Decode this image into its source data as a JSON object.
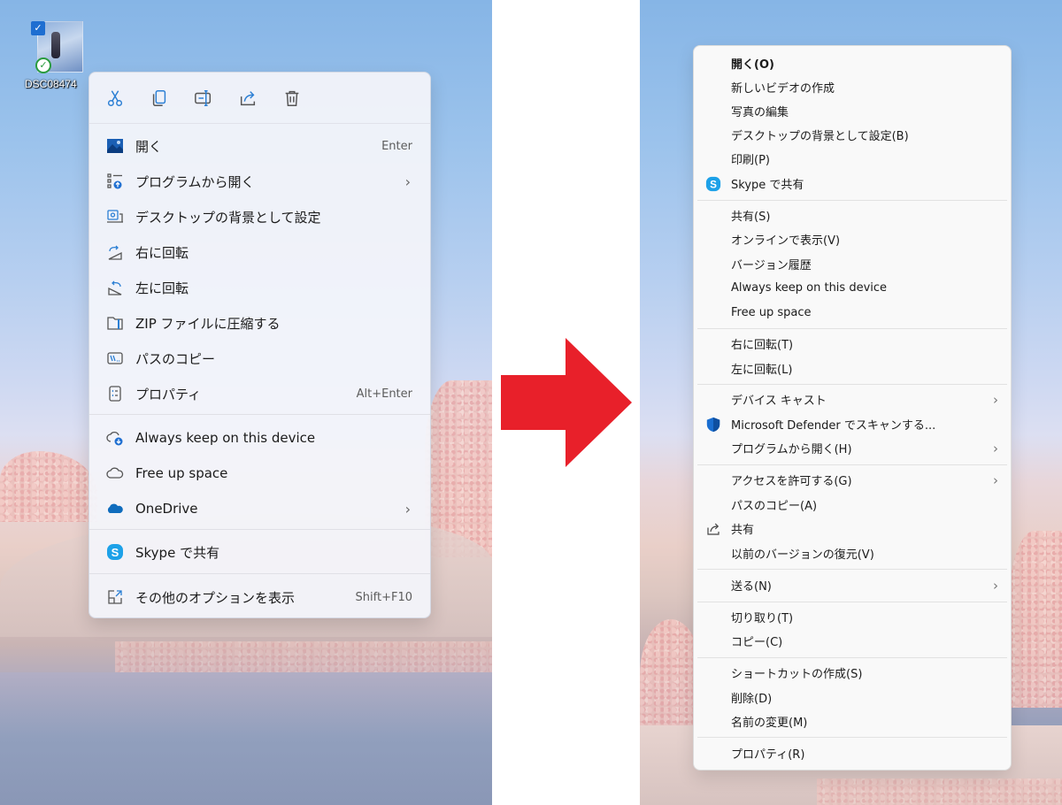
{
  "desktop_icon": {
    "filename": "DSC08474",
    "selected": true,
    "sync_status": "synced"
  },
  "left_menu": {
    "toolbar": [
      {
        "icon": "scissors-icon",
        "tooltip": "Cut"
      },
      {
        "icon": "copy-icon",
        "tooltip": "Copy"
      },
      {
        "icon": "rename-icon",
        "tooltip": "Rename"
      },
      {
        "icon": "share-icon",
        "tooltip": "Share"
      },
      {
        "icon": "trash-icon",
        "tooltip": "Delete"
      }
    ],
    "items": [
      {
        "label": "開く",
        "icon": "photo-icon",
        "accel": "Enter"
      },
      {
        "label": "プログラムから開く",
        "icon": "open-with-icon",
        "submenu": true
      },
      {
        "label": "デスクトップの背景として設定",
        "icon": "wallpaper-icon"
      },
      {
        "label": "右に回転",
        "icon": "rotate-right-icon"
      },
      {
        "label": "左に回転",
        "icon": "rotate-left-icon"
      },
      {
        "label": "ZIP ファイルに圧縮する",
        "icon": "zip-folder-icon"
      },
      {
        "label": "パスのコピー",
        "icon": "copy-path-icon"
      },
      {
        "label": "プロパティ",
        "icon": "properties-icon",
        "accel": "Alt+Enter"
      },
      {
        "label": "Always keep on this device",
        "icon": "cloud-download-icon"
      },
      {
        "label": "Free up space",
        "icon": "cloud-outline-icon"
      },
      {
        "label": "OneDrive",
        "icon": "onedrive-icon",
        "submenu": true
      },
      {
        "label": "Skype で共有",
        "icon": "skype-icon"
      },
      {
        "label": "その他のオプションを表示",
        "icon": "more-options-icon",
        "accel": "Shift+F10"
      }
    ],
    "chevron": "›"
  },
  "right_menu": {
    "items": [
      {
        "label": "開く(O)",
        "bold": true
      },
      {
        "label": "新しいビデオの作成"
      },
      {
        "label": "写真の編集"
      },
      {
        "label": "デスクトップの背景として設定(B)"
      },
      {
        "label": "印刷(P)"
      },
      {
        "label": "Skype で共有",
        "icon": "skype-icon"
      },
      {
        "label": "共有(S)"
      },
      {
        "label": "オンラインで表示(V)"
      },
      {
        "label": "バージョン履歴"
      },
      {
        "label": "Always keep on this device"
      },
      {
        "label": "Free up space"
      },
      {
        "label": "右に回転(T)"
      },
      {
        "label": "左に回転(L)"
      },
      {
        "label": "デバイス キャスト",
        "submenu": true
      },
      {
        "label": "Microsoft Defender でスキャンする...",
        "icon": "defender-shield-icon"
      },
      {
        "label": "プログラムから開く(H)",
        "submenu": true
      },
      {
        "label": "アクセスを許可する(G)",
        "submenu": true
      },
      {
        "label": "パスのコピー(A)"
      },
      {
        "label": "共有",
        "icon": "share-icon"
      },
      {
        "label": "以前のバージョンの復元(V)"
      },
      {
        "label": "送る(N)",
        "submenu": true
      },
      {
        "label": "切り取り(T)"
      },
      {
        "label": "コピー(C)"
      },
      {
        "label": "ショートカットの作成(S)"
      },
      {
        "label": "削除(D)"
      },
      {
        "label": "名前の変更(M)"
      },
      {
        "label": "プロパティ(R)"
      }
    ],
    "chevron": "›"
  },
  "colors": {
    "arrow": "#e8202a",
    "accent": "#0f6cbd",
    "skype": "#1da1e8"
  }
}
